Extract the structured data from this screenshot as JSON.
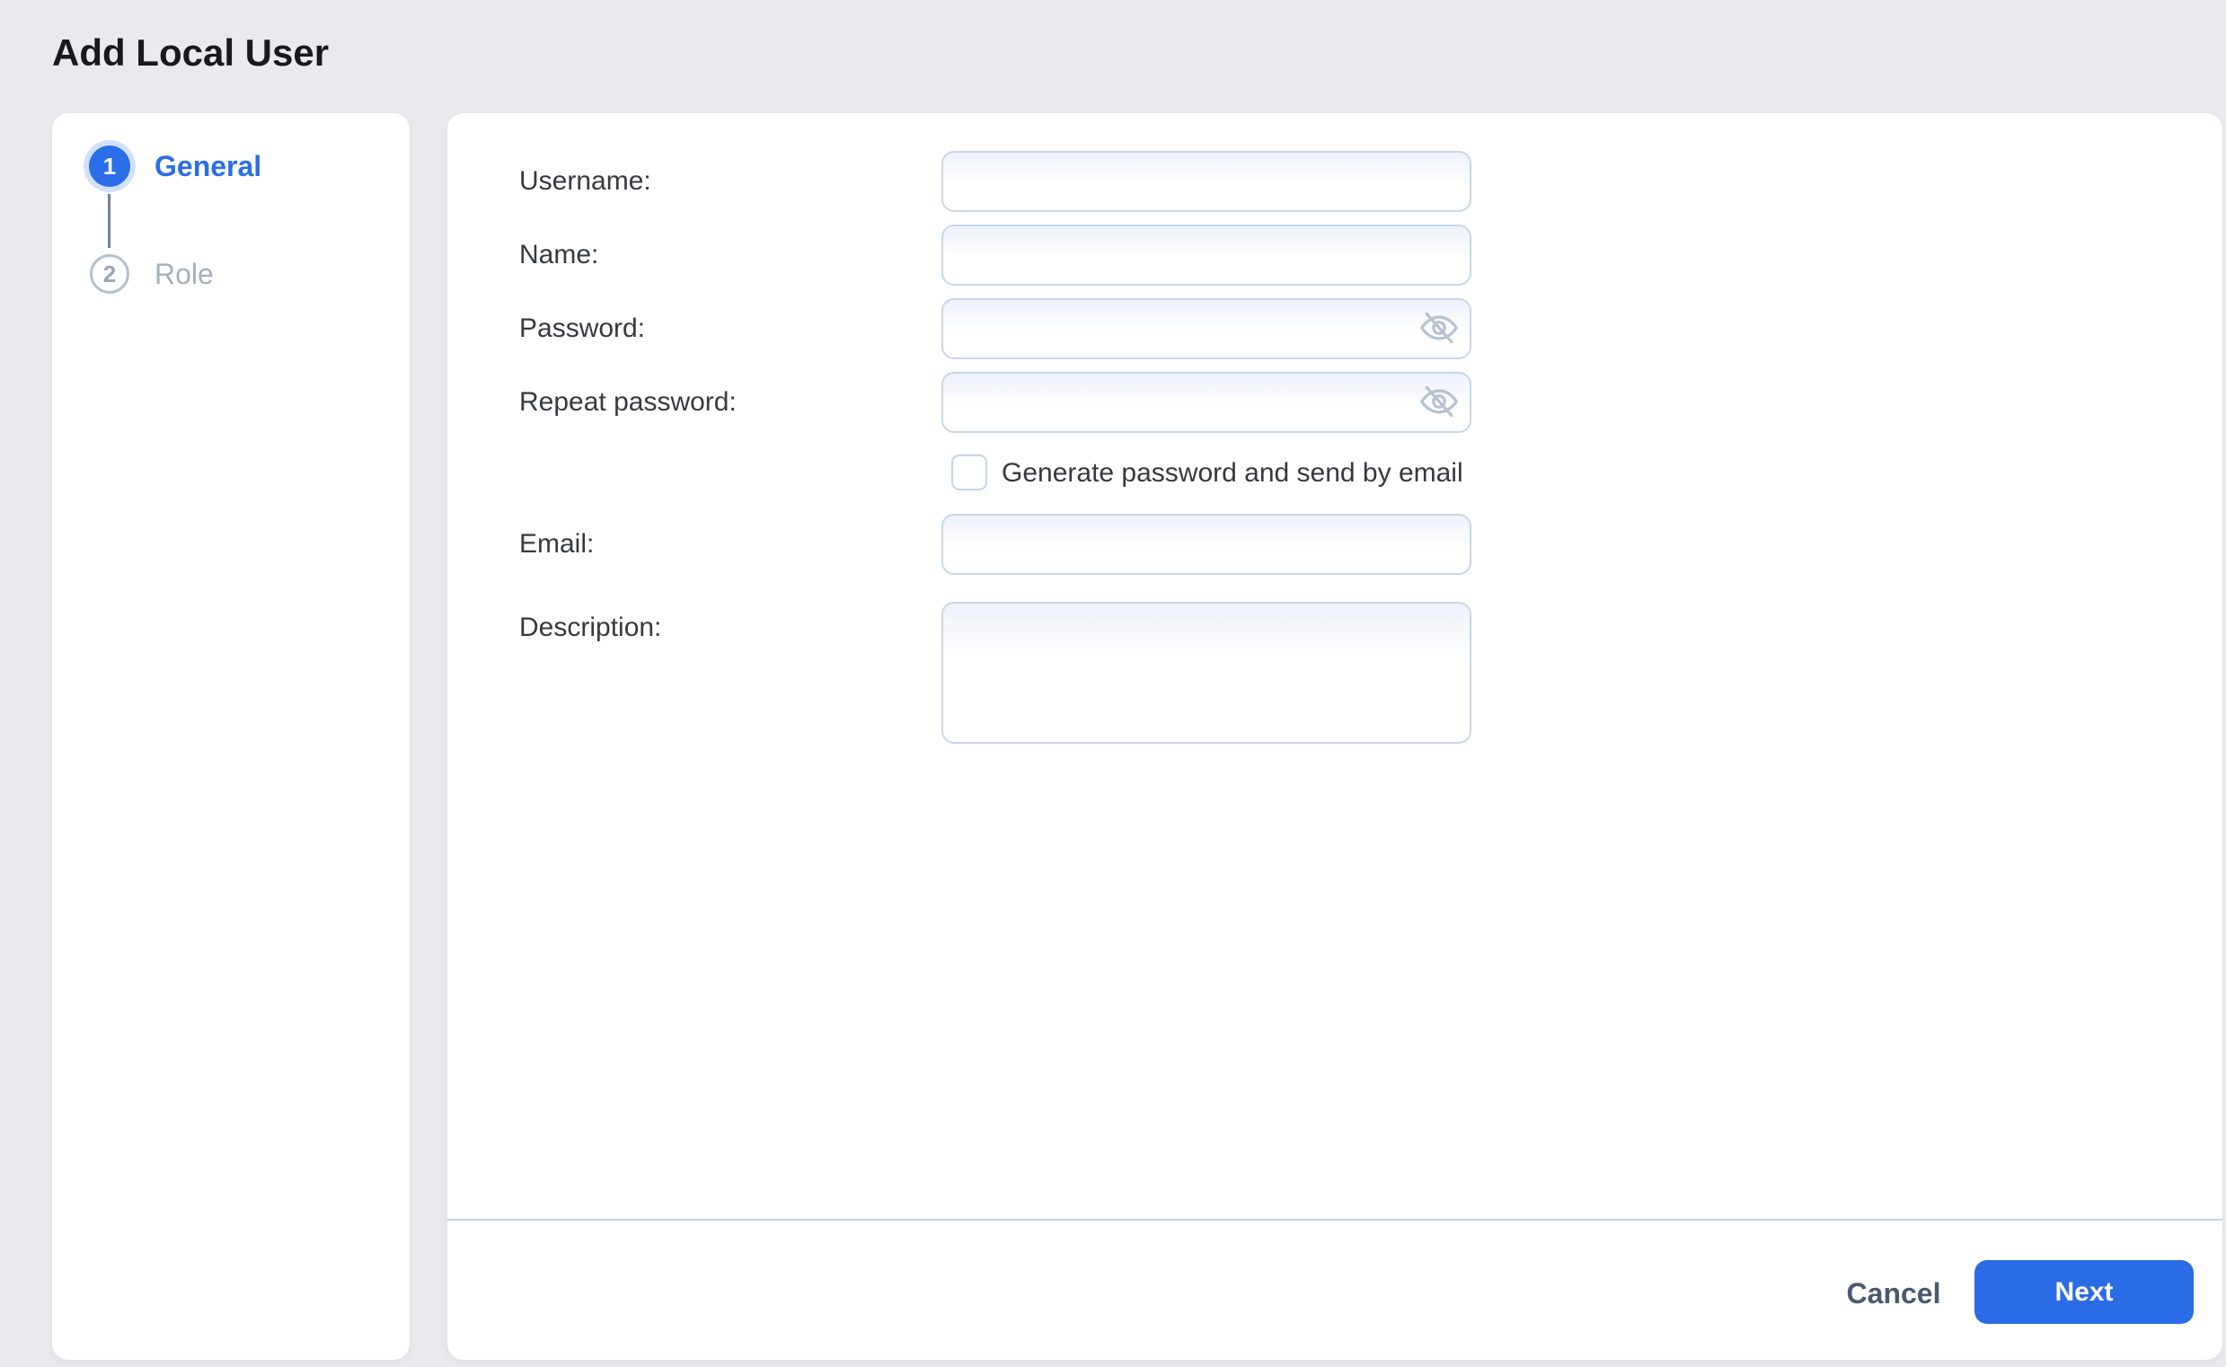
{
  "page": {
    "title": "Add Local User",
    "background_color": "#e8eaee",
    "accent_color": "#2b6ee7"
  },
  "wizard": {
    "steps": [
      {
        "number": "1",
        "label": "General",
        "state": "active"
      },
      {
        "number": "2",
        "label": "Role",
        "state": "inactive"
      }
    ]
  },
  "form": {
    "username_label": "Username:",
    "name_label": "Name:",
    "password_label": "Password:",
    "repeat_password_label": "Repeat password:",
    "generate_checkbox_label": "Generate password and send by email",
    "email_label": "Email:",
    "description_label": "Description:",
    "values": {
      "username": "",
      "name": "",
      "password": "",
      "repeat_password": "",
      "email": "",
      "description": ""
    },
    "generate_checkbox_checked": "false",
    "icons": {
      "password_visibility": "eye-off-icon"
    }
  },
  "footer": {
    "cancel_label": "Cancel",
    "next_label": "Next"
  }
}
